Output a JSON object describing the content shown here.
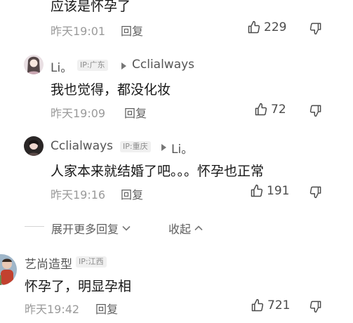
{
  "comments": [
    {
      "content": "应该是怀孕了",
      "time": "昨天19:01",
      "reply_label": "回复",
      "likes": "229"
    },
    {
      "username": "Li。",
      "ip": "IP:广东",
      "reply_to": "Cclialways",
      "content": "我也觉得，都没化妆",
      "time": "昨天19:09",
      "reply_label": "回复",
      "likes": "72"
    },
    {
      "username": "Cclialways",
      "ip": "IP:重庆",
      "reply_to": "Li。",
      "content": "人家本来就结婚了吧。。。怀孕也正常",
      "time": "昨天19:16",
      "reply_label": "回复",
      "likes": "191"
    },
    {
      "username": "艺尚造型",
      "ip": "IP:江西",
      "content": "怀孕了，明显孕相",
      "time": "昨天19:42",
      "reply_label": "回复",
      "likes": "721"
    }
  ],
  "thread_controls": {
    "expand_label": "展开更多回复",
    "collapse_label": "收起"
  },
  "icons": {
    "like": "thumbs-up-icon",
    "dislike": "thumbs-down-icon",
    "expand": "chevron-down-icon",
    "collapse": "chevron-up-icon",
    "reply_arrow": "triangle-right-icon"
  }
}
